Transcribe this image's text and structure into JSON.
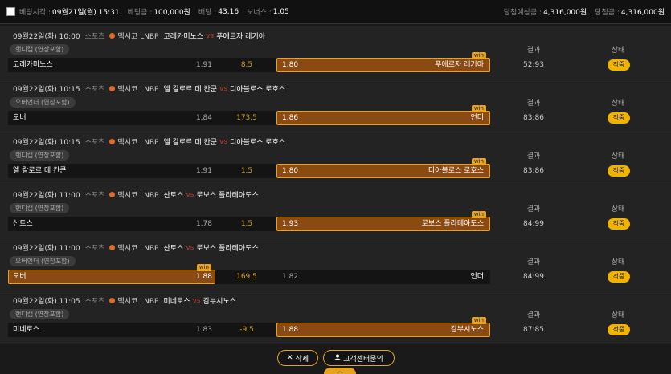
{
  "header": {
    "time_label": "베팅시각 :",
    "time_value": "09월21일(월) 15:31",
    "amount_label": "베팅금 :",
    "amount_value": "100,000원",
    "odds_label": "배당 :",
    "odds_value": "43.16",
    "bonus_label": "보너스 :",
    "bonus_value": "1.05",
    "expected_label": "당첨예상금 :",
    "expected_value": "4,316,000원",
    "won_label": "당첨금 :",
    "won_value": "4,316,000원"
  },
  "labels": {
    "result": "결과",
    "status": "상태",
    "win": "win",
    "vs": "vs"
  },
  "bets": [
    {
      "date": "09월22일(화) 10:00",
      "sport": "스포츠",
      "league": "멕시코 LNBP",
      "home": "코레카미노스",
      "away": "푸에르자 레기아",
      "market": "핸디캡 (연장포함)",
      "home_pick": "코레카미노스",
      "home_odds": "1.91",
      "handicap": "8.5",
      "away_odds": "1.80",
      "away_pick": "푸에르자 레기아",
      "selected": "away",
      "score": "52:93",
      "status": "적중"
    },
    {
      "date": "09월22일(화) 10:15",
      "sport": "스포츠",
      "league": "멕시코 LNBP",
      "home": "엘 칼로르 데 칸쿤",
      "away": "디아블로스 로호스",
      "market": "오버언더 (연장포함)",
      "home_pick": "오버",
      "home_odds": "1.84",
      "handicap": "173.5",
      "away_odds": "1.86",
      "away_pick": "언더",
      "selected": "away",
      "score": "83:86",
      "status": "적중"
    },
    {
      "date": "09월22일(화) 10:15",
      "sport": "스포츠",
      "league": "멕시코 LNBP",
      "home": "엘 칼로르 데 칸쿤",
      "away": "디아블로스 로호스",
      "market": "핸디캡 (연장포함)",
      "home_pick": "엘 칼로르 데 칸쿤",
      "home_odds": "1.91",
      "handicap": "1.5",
      "away_odds": "1.80",
      "away_pick": "디아블로스 로호스",
      "selected": "away",
      "score": "83:86",
      "status": "적중"
    },
    {
      "date": "09월22일(화) 11:00",
      "sport": "스포츠",
      "league": "멕시코 LNBP",
      "home": "산토스",
      "away": "로보스 플라테아도스",
      "market": "핸디캡 (연장포함)",
      "home_pick": "산토스",
      "home_odds": "1.78",
      "handicap": "1.5",
      "away_odds": "1.93",
      "away_pick": "로보스 플라테아도스",
      "selected": "away",
      "score": "84:99",
      "status": "적중"
    },
    {
      "date": "09월22일(화) 11:00",
      "sport": "스포츠",
      "league": "멕시코 LNBP",
      "home": "산토스",
      "away": "로보스 플라테아도스",
      "market": "오버언더 (연장포함)",
      "home_pick": "오버",
      "home_odds": "1.88",
      "handicap": "169.5",
      "away_odds": "1.82",
      "away_pick": "언더",
      "selected": "home",
      "score": "84:99",
      "status": "적중"
    },
    {
      "date": "09월22일(화) 11:05",
      "sport": "스포츠",
      "league": "멕시코 LNBP",
      "home": "미네로스",
      "away": "캄부시노스",
      "market": "핸디캡 (연장포함)",
      "home_pick": "미네로스",
      "home_odds": "1.83",
      "handicap": "-9.5",
      "away_odds": "1.88",
      "away_pick": "캄부시노스",
      "selected": "away",
      "score": "87:85",
      "status": "적중"
    }
  ],
  "footer": {
    "delete_label": "삭제",
    "support_label": "고객센터문의"
  },
  "colors": {
    "accent": "#e6a320",
    "selected_bg": "#8a4a12",
    "badge": "#f0b400",
    "vs": "#c0392b"
  }
}
